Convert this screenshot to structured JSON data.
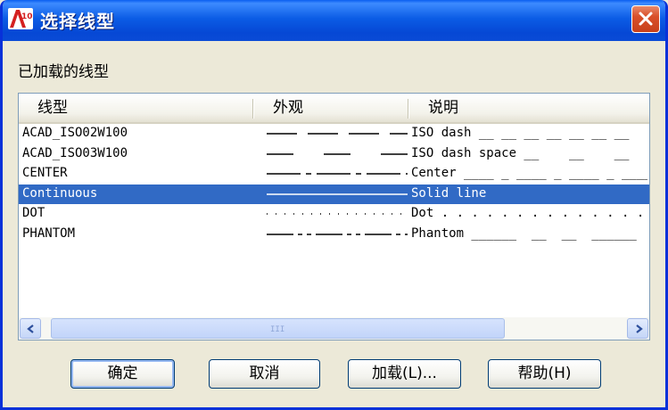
{
  "window": {
    "title": "选择线型",
    "app_icon_text": "A10"
  },
  "group_label": "已加载的线型",
  "columns": [
    "线型",
    "外观",
    "说明"
  ],
  "rows": [
    {
      "name": "ACAD_ISO02W100",
      "desc": "ISO dash __ __ __ __ __ __ __",
      "pattern": "iso02",
      "selected": false
    },
    {
      "name": "ACAD_ISO03W100",
      "desc": "ISO dash space __    __    __",
      "pattern": "iso03",
      "selected": false
    },
    {
      "name": "CENTER",
      "desc": "Center ____ _ ____ _ ____ _ ____",
      "pattern": "center",
      "selected": false
    },
    {
      "name": "Continuous",
      "desc": "Solid line",
      "pattern": "solid",
      "selected": true
    },
    {
      "name": "DOT",
      "desc": "Dot . . . . . . . . . . . . . . . . .",
      "pattern": "dot",
      "selected": false
    },
    {
      "name": "PHANTOM",
      "desc": "Phantom ______  __  __  ______",
      "pattern": "phantom",
      "selected": false
    }
  ],
  "scrollbar": {
    "grip": "III"
  },
  "buttons": {
    "ok": "确定",
    "cancel": "取消",
    "load": "加载(L)...",
    "help": "帮助(H)"
  },
  "colors": {
    "selection": "#316ac5",
    "title_bar": "#0b5ce5"
  }
}
